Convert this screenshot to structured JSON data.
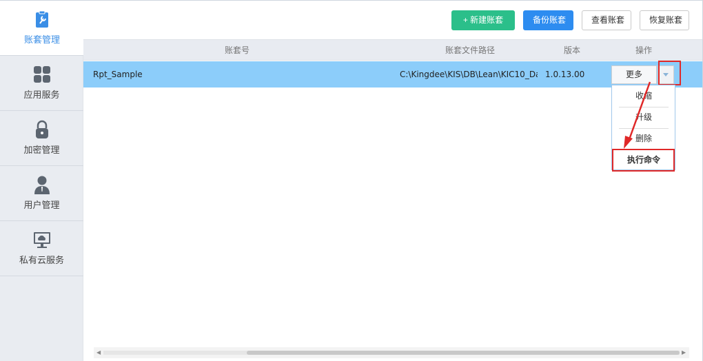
{
  "sidebar": {
    "items": [
      {
        "label": "账套管理",
        "icon": "wrench-clipboard-icon",
        "active": true
      },
      {
        "label": "应用服务",
        "icon": "grid-apps-icon"
      },
      {
        "label": "加密管理",
        "icon": "lock-icon"
      },
      {
        "label": "用户管理",
        "icon": "user-icon"
      },
      {
        "label": "私有云服务",
        "icon": "cloud-monitor-icon"
      }
    ]
  },
  "toolbar": {
    "new_label": "+ 新建账套",
    "backup_label": "备份账套",
    "view_label": "查看账套",
    "restore_label": "恢复账套"
  },
  "table": {
    "columns": [
      "账套号",
      "账套文件路径",
      "版本",
      "操作"
    ],
    "rows": [
      {
        "name": "Rpt_Sample",
        "path": "C:\\Kingdee\\KIS\\DB\\Lean\\KIC10_Da",
        "version": "1.0.13.00",
        "more_label": "更多"
      }
    ]
  },
  "dropdown": {
    "items": [
      "收缩",
      "升级",
      "删除",
      "执行命令"
    ]
  },
  "colors": {
    "accent": "#2d8cf0",
    "green": "#2bbf8a",
    "selected_row": "#8ccdfa",
    "highlight": "#e02828"
  }
}
